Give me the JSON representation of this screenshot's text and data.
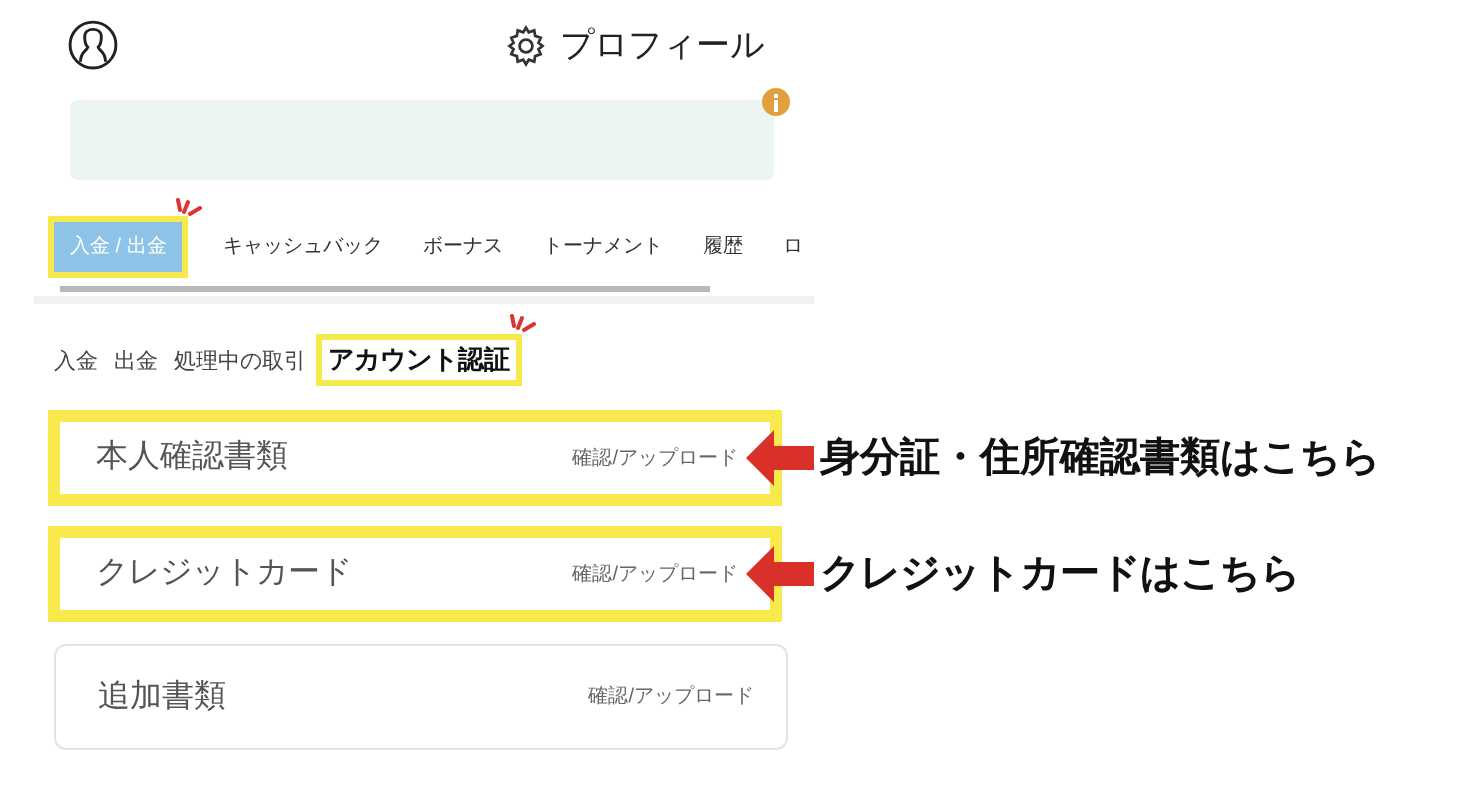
{
  "header": {
    "title": "プロフィール"
  },
  "tabs": [
    {
      "label": "入金 / 出金",
      "selected": true,
      "highlighted": true
    },
    {
      "label": "キャッシュバック",
      "selected": false,
      "highlighted": false
    },
    {
      "label": "ボーナス",
      "selected": false,
      "highlighted": false
    },
    {
      "label": "トーナメント",
      "selected": false,
      "highlighted": false
    },
    {
      "label": "履歴",
      "selected": false,
      "highlighted": false
    },
    {
      "label": "ロ",
      "selected": false,
      "highlighted": false
    }
  ],
  "subtabs": [
    {
      "label": "入金",
      "selected": false,
      "highlighted": false
    },
    {
      "label": "出金",
      "selected": false,
      "highlighted": false
    },
    {
      "label": "処理中の取引",
      "selected": false,
      "highlighted": false
    },
    {
      "label": "アカウント認証",
      "selected": true,
      "highlighted": true
    }
  ],
  "documents": [
    {
      "name": "本人確認書類",
      "action": "確認/アップロード",
      "highlighted": true,
      "callout": "身分証・住所確認書類はこちら"
    },
    {
      "name": "クレジットカード",
      "action": "確認/アップロード",
      "highlighted": true,
      "callout": "クレジットカードはこちら"
    },
    {
      "name": "追加書類",
      "action": "確認/アップロード",
      "highlighted": false
    }
  ]
}
